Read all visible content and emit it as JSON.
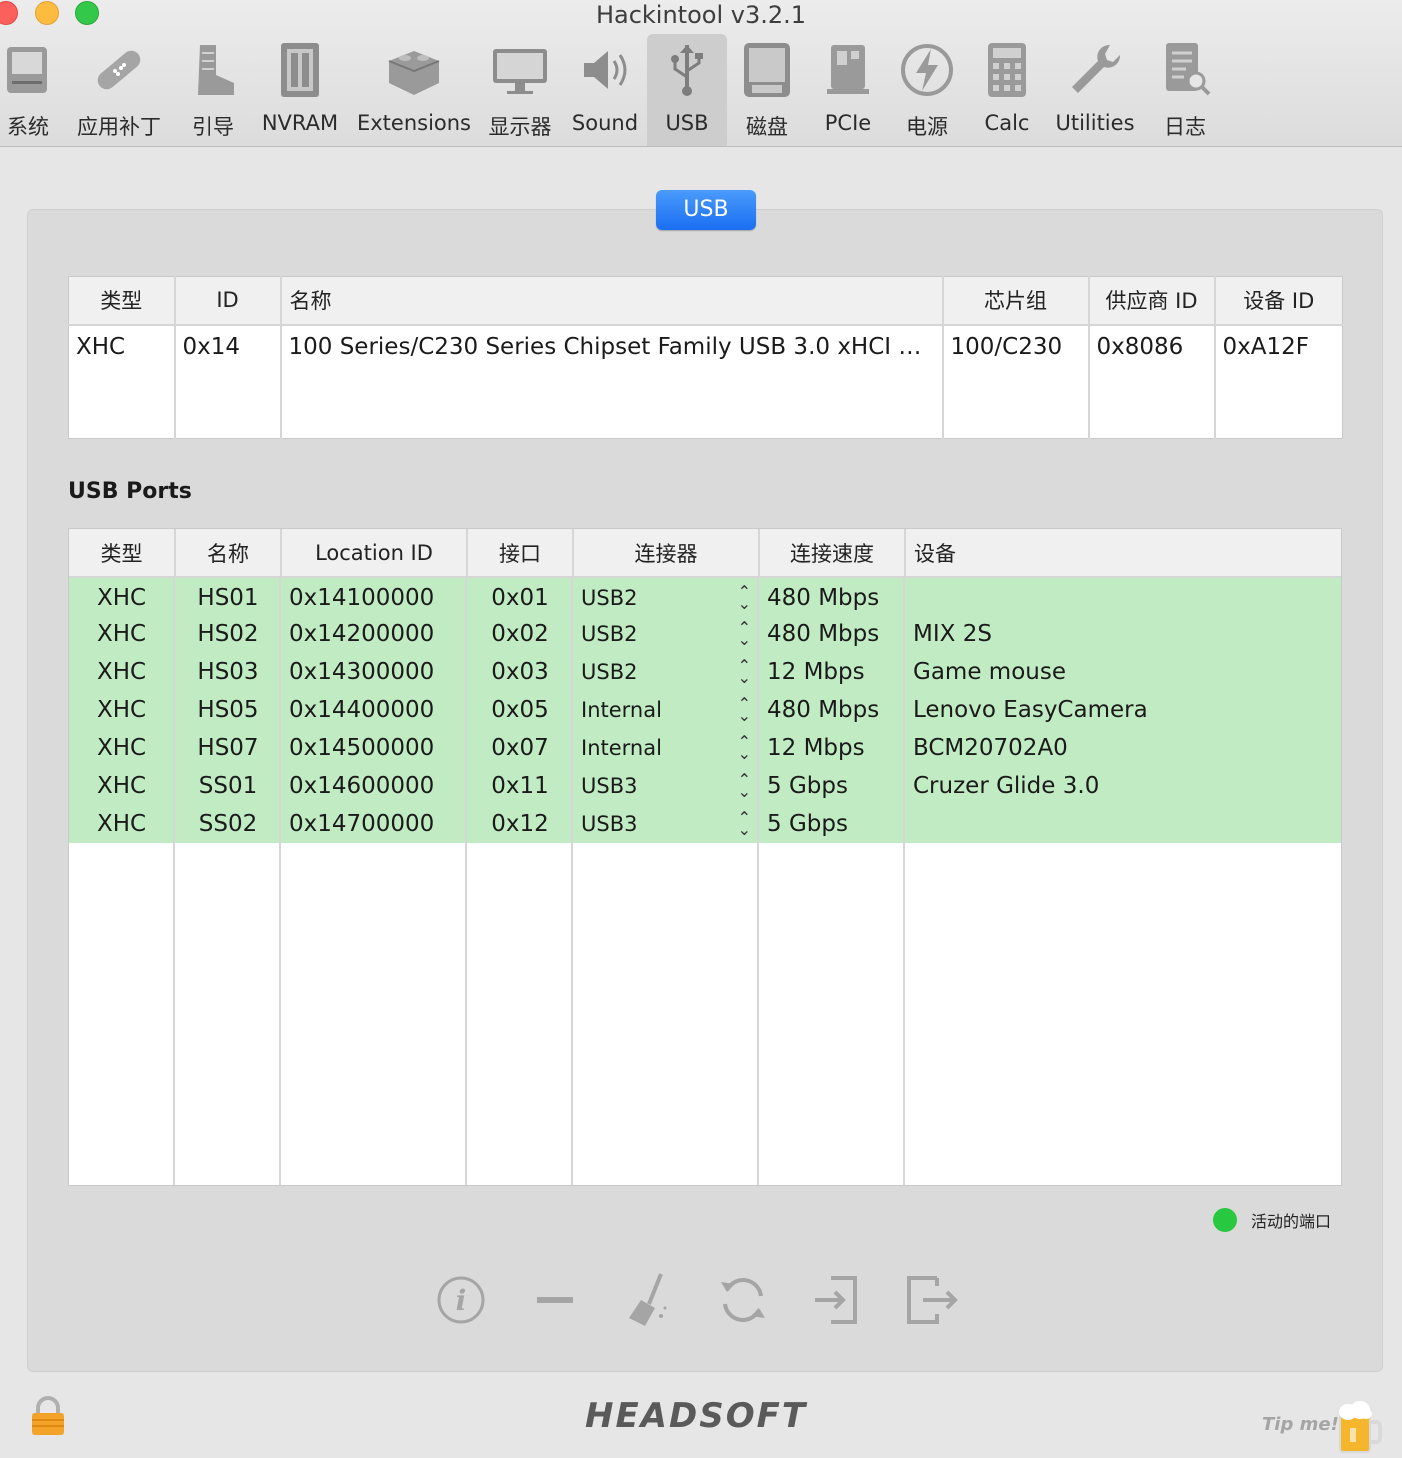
{
  "window": {
    "title": "Hackintool v3.2.1"
  },
  "toolbar": {
    "items": [
      {
        "label": "系统",
        "icon": "computer-icon"
      },
      {
        "label": "应用补丁",
        "icon": "bandage-icon"
      },
      {
        "label": "引导",
        "icon": "boot-icon"
      },
      {
        "label": "NVRAM",
        "icon": "memory-icon"
      },
      {
        "label": "Extensions",
        "icon": "lego-brick-icon"
      },
      {
        "label": "显示器",
        "icon": "display-icon"
      },
      {
        "label": "Sound",
        "icon": "speaker-icon"
      },
      {
        "label": "USB",
        "icon": "usb-icon"
      },
      {
        "label": "磁盘",
        "icon": "disk-icon"
      },
      {
        "label": "PCIe",
        "icon": "pcie-card-icon"
      },
      {
        "label": "电源",
        "icon": "power-bolt-icon"
      },
      {
        "label": "Calc",
        "icon": "calculator-icon"
      },
      {
        "label": "Utilities",
        "icon": "wrench-icon"
      },
      {
        "label": "日志",
        "icon": "log-search-icon"
      }
    ],
    "selected": "USB"
  },
  "section_tab": {
    "label": "USB"
  },
  "controller_table": {
    "headers": [
      "类型",
      "ID",
      "名称",
      "芯片组",
      "供应商 ID",
      "设备 ID"
    ],
    "rows": [
      [
        "XHC",
        "0x14",
        "100 Series/C230 Series Chipset Family USB 3.0 xHCI C...",
        "100/C230",
        "0x8086",
        "0xA12F"
      ]
    ]
  },
  "ports_section": {
    "title": "USB Ports"
  },
  "ports_table": {
    "headers": [
      "类型",
      "名称",
      "Location ID",
      "接口",
      "连接器",
      "连接速度",
      "设备"
    ],
    "rows": [
      [
        "XHC",
        "HS01",
        "0x14100000",
        "0x01",
        "USB2",
        "480 Mbps",
        ""
      ],
      [
        "XHC",
        "HS02",
        "0x14200000",
        "0x02",
        "USB2",
        "480 Mbps",
        "MIX 2S"
      ],
      [
        "XHC",
        "HS03",
        "0x14300000",
        "0x03",
        "USB2",
        "12 Mbps",
        "Game mouse"
      ],
      [
        "XHC",
        "HS05",
        "0x14400000",
        "0x05",
        "Internal",
        "480 Mbps",
        "Lenovo EasyCamera"
      ],
      [
        "XHC",
        "HS07",
        "0x14500000",
        "0x07",
        "Internal",
        "12 Mbps",
        "BCM20702A0"
      ],
      [
        "XHC",
        "SS01",
        "0x14600000",
        "0x11",
        "USB3",
        "5 Gbps",
        "Cruzer Glide 3.0"
      ],
      [
        "XHC",
        "SS02",
        "0x14700000",
        "0x12",
        "USB3",
        "5 Gbps",
        ""
      ]
    ],
    "active_row_color": "#c1ecc3"
  },
  "legend": {
    "label": "活动的端口",
    "color": "#28c840"
  },
  "actions": [
    "info-icon",
    "minus-icon",
    "broom-icon",
    "refresh-icon",
    "import-icon",
    "export-icon"
  ],
  "footer": {
    "brand": "HEADSOFT",
    "tip": "Tip me!"
  }
}
